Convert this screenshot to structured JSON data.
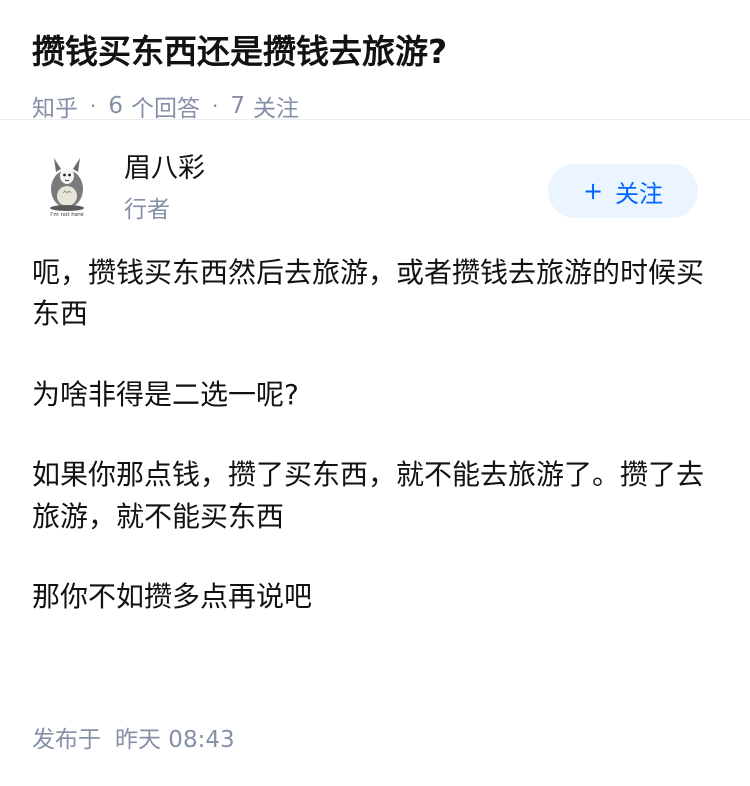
{
  "question": {
    "title": "攒钱买东西还是攒钱去旅游?",
    "source": "知乎",
    "answer_count": "6",
    "answer_label": "个回答",
    "follower_count": "7",
    "follower_label": "关注"
  },
  "answer": {
    "author": {
      "name": "眉八彩",
      "headline": "行者",
      "avatar_icon": "totoro-avatar-icon",
      "avatar_caption": "I'm not here"
    },
    "follow_button": {
      "icon": "+",
      "label": "关注"
    },
    "paragraphs": [
      "呃，攒钱买东西然后去旅游，或者攒钱去旅游的时候买东西",
      "为啥非得是二选一呢?",
      "如果你那点钱，攒了买东西，就不能去旅游了。攒了去旅游，就不能买东西",
      "那你不如攒多点再说吧"
    ],
    "post_label": "发布于",
    "post_time": "昨天 08:43"
  },
  "colors": {
    "primary_text": "#121212",
    "secondary_text": "#8590a6",
    "follow_bg": "#ebf5ff",
    "follow_text": "#0066ff"
  }
}
